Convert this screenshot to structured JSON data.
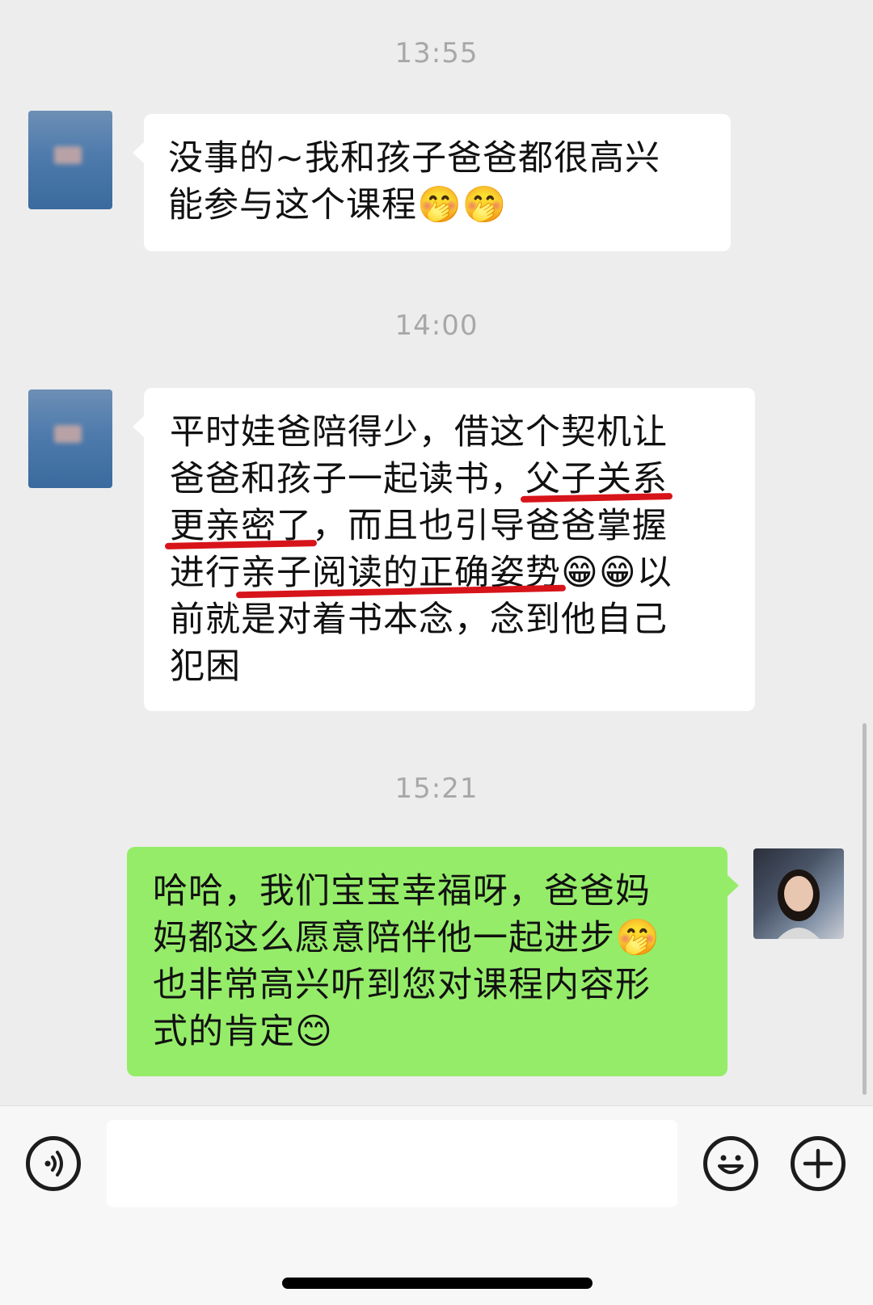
{
  "messages": [
    {
      "timestamp": "13:55",
      "lines": [
        "没事的~我和孩子爸爸都很高兴",
        "能参与这个课程"
      ],
      "emoji": "🤭🤭"
    },
    {
      "timestamp": "14:00",
      "line1": "平时娃爸陪得少，借这个契机让",
      "line2_a": "爸爸和孩子一起读书，",
      "line2_u": "父子关系",
      "line3_u": "更亲密了",
      "line3_b": "，而且也引导爸爸掌握",
      "line4_a": "进行",
      "line4_u": "亲子阅读的正确姿势",
      "line4_emoji": "😁😁",
      "line4_b": "以",
      "line5": "前就是对着书本念，念到他自己",
      "line6": "犯困"
    },
    {
      "timestamp": "15:21",
      "line1": "哈哈，我们宝宝幸福呀，爸爸妈",
      "line2": "妈都这么愿意陪伴他一起进步",
      "line2_emoji": "🤭",
      "line3": "也非常高兴听到您对课程内容形",
      "line4": "式的肯定",
      "line4_emoji": "😊"
    }
  ],
  "icons": {
    "voice": "voice-icon",
    "emoji": "emoji-icon",
    "plus": "plus-icon"
  },
  "input": {
    "value": ""
  },
  "colors": {
    "outgoing_bubble": "#95ec69",
    "incoming_bubble": "#ffffff",
    "underline": "#d7141a"
  }
}
